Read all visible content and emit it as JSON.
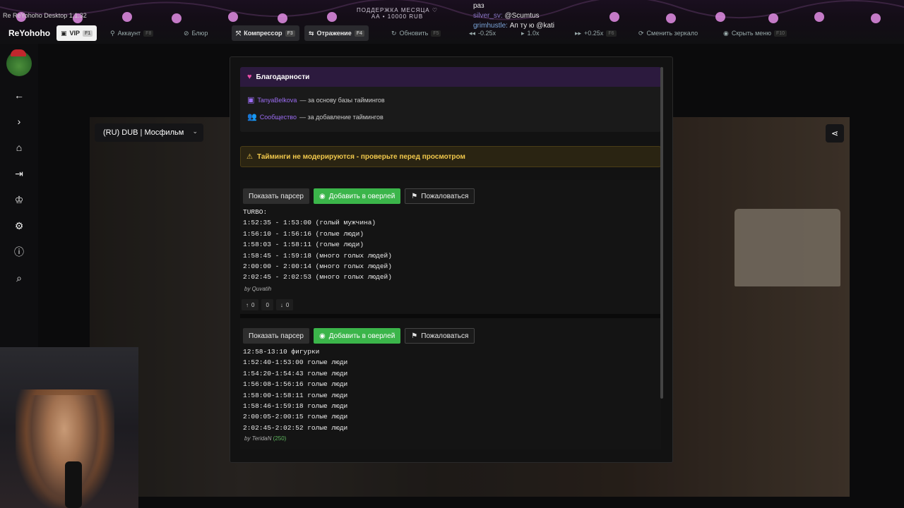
{
  "window": {
    "title": "ReYohoho Desktop 1.1.32",
    "title_prefix": "Re"
  },
  "toolbar": {
    "brand": "ReYohoho",
    "vip": {
      "label": "VIP",
      "key": "F1"
    },
    "account": {
      "label": "Аккаунт",
      "key": "F8"
    },
    "blur": {
      "label": "Блюр"
    },
    "compressor": {
      "label": "Компрессор",
      "key": "F3"
    },
    "mirror": {
      "label": "Отражение",
      "key": "F4"
    },
    "refresh": {
      "label": "Обновить",
      "key": "F5"
    },
    "speed_down": {
      "label": "-0.25x"
    },
    "speed_reset": {
      "label": "1.0x"
    },
    "speed_up": {
      "label": "+0.25x",
      "key": "F6"
    },
    "switch_mirror": {
      "label": "Сменить зеркало"
    },
    "hide_menu": {
      "label": "Скрыть меню",
      "key": "F10"
    }
  },
  "overlay": {
    "donation_title": "ПОДДЕРЖКА МЕСЯЦА ♡",
    "donation_sub": "АА • 10000 RUB",
    "chat_top": "раз",
    "chat1_user": "silver_sv:",
    "chat1_text": "@Scumtus",
    "chat2_user": "grimhustle:",
    "chat2_text": "Ап ту ю @kati"
  },
  "sidebar": {
    "icons": [
      "back-arrow-icon",
      "forward-arrow-icon",
      "home-icon",
      "login-icon",
      "trophy-icon",
      "gear-icon",
      "info-icon",
      "search-icon"
    ]
  },
  "player": {
    "dub_select": "(RU) DUB | Мосфильм"
  },
  "panel": {
    "thanks_title": "Благодарности",
    "thanks_row1_name": "TanyaBelkova",
    "thanks_row1_text": "— за основу базы таймингов",
    "thanks_row2_name": "Сообщество",
    "thanks_row2_text": "— за добавление таймингов",
    "warning": "Тайминги не модерируются - проверьте перед просмотром",
    "show_parser": "Показать парсер",
    "add_overlay": "Добавить в оверлей",
    "report": "Пожаловаться",
    "blocks": [
      {
        "lines": [
          "TURBO:",
          "1:52:35 - 1:53:00 (голый мужчина)",
          "1:56:10 - 1:56:16 (голые люди)",
          "1:58:03 - 1:58:11 (голые люди)",
          "1:58:45 - 1:59:18 (много голых людей)",
          "2:00:00 - 2:00:14 (много голых людей)",
          "2:02:45 - 2:02:53 (много голых людей)"
        ],
        "by": "by Quvatih",
        "votes_up": "0",
        "votes_mid": "0",
        "votes_down": "0"
      },
      {
        "lines": [
          "12:58-13:10 фигурки",
          "1:52:40-1:53:00 голые люди",
          "1:54:20-1:54:43 голые люди",
          "1:56:08-1:56:16 голые люди",
          "1:58:00-1:58:11 голые люди",
          "1:58:46-1:59:18 голые люди",
          "2:00:05-2:00:15 голые люди",
          "2:02:45-2:02:52 голые люди"
        ],
        "by": "by TeridaN",
        "by_count": "(250)"
      }
    ]
  }
}
